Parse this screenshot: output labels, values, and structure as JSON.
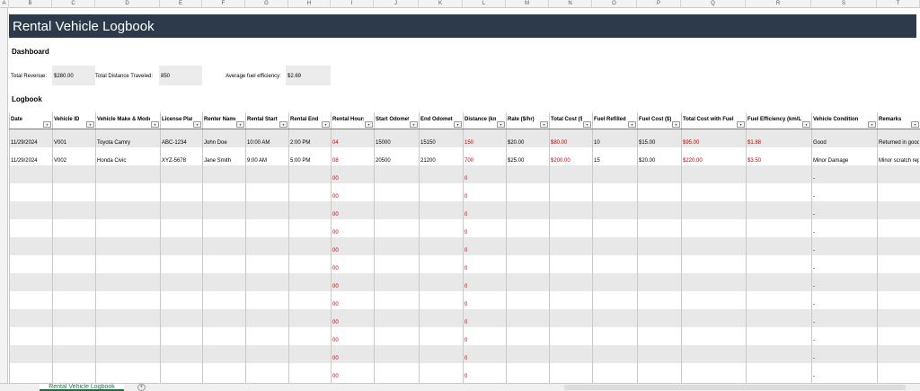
{
  "column_letters": [
    "A",
    "B",
    "C",
    "D",
    "E",
    "F",
    "G",
    "H",
    "I",
    "J",
    "K",
    "L",
    "M",
    "N",
    "O",
    "P",
    "Q",
    "R",
    "S",
    "T"
  ],
  "title": "Rental Vehicle Logbook",
  "dashboard": {
    "heading": "Dashboard",
    "total_revenue_label": "Total Revenue:",
    "total_revenue_value": "$280.00",
    "total_distance_label": "Total Distance Traveled:",
    "total_distance_value": "850",
    "avg_fuel_label": "Average fuel efficiency:",
    "avg_fuel_value": "$2.69"
  },
  "logbook_heading": "Logbook",
  "table": {
    "headers": [
      "Date",
      "Vehicle ID",
      "Vehicle Make & Model",
      "License Plate",
      "Renter Name",
      "Rental Start",
      "Rental End",
      "Rental Hours",
      "Start Odometer",
      "End Odometer",
      "Distance (km)",
      "Rate ($/hr)",
      "Total Cost ($)",
      "Fuel Refilled (L)",
      "Fuel Cost ($)",
      "Total Cost with Fuel",
      "Fuel Efficiency (km/L)",
      "Vehicle Condition",
      "Remarks"
    ],
    "rows": [
      [
        "11/29/2024",
        "V001",
        "Toyota Camry",
        "ABC-1234",
        "John Doe",
        "10:00 AM",
        "2:00 PM",
        "04",
        "15000",
        "15150",
        "150",
        "$20.00",
        "$80.00",
        "10",
        "$15.00",
        "$95.00",
        "$1.88",
        "Good",
        "Returned in good condition"
      ],
      [
        "11/29/2024",
        "V002",
        "Honda Civic",
        "XYZ-5678",
        "Jane Smith",
        "9:00 AM",
        "5:00 PM",
        "08",
        "20500",
        "21200",
        "700",
        "$25.00",
        "$200.00",
        "15",
        "$20.00",
        "$220.00",
        "$3.50",
        "Minor Damage",
        "Minor scratch reported"
      ]
    ],
    "red_columns": [
      7,
      10,
      12,
      15,
      16
    ],
    "empty_row": {
      "rental_hours": "00",
      "distance": "0",
      "condition": "-"
    },
    "empty_row_count": 12
  },
  "sheet_tab": "Rental Vehicle Logbook",
  "add_sheet_symbol": "+"
}
